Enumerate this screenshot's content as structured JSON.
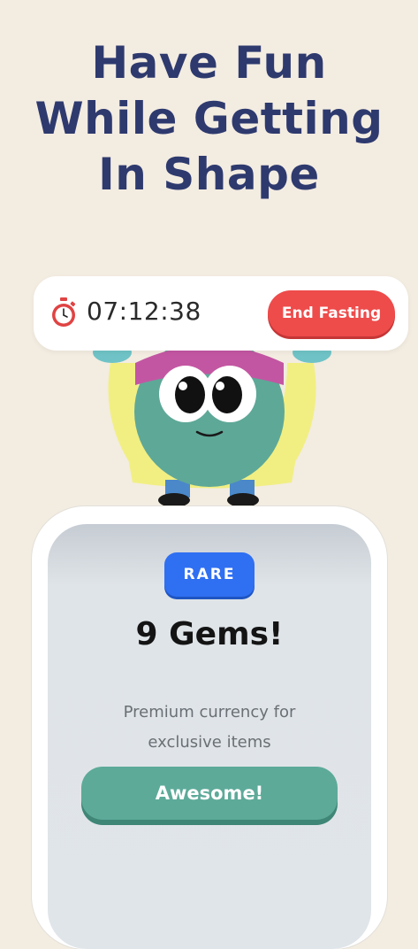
{
  "headline": {
    "line1": "Have Fun",
    "line2": "While Getting",
    "line3": "In Shape"
  },
  "timer": {
    "icon": "stopwatch-icon",
    "elapsed": "07:12:38",
    "end_button_label": "End Fasting"
  },
  "reward": {
    "badge": "RARE",
    "title": "9 Gems!",
    "description_line1": "Premium currency for",
    "description_line2": "exclusive items",
    "button_label": "Awesome!"
  },
  "colors": {
    "background": "#f3ece1",
    "headline": "#2e3a6e",
    "end_button": "#ee4b4b",
    "badge": "#2f6ff2",
    "awesome_button": "#5daa99"
  }
}
